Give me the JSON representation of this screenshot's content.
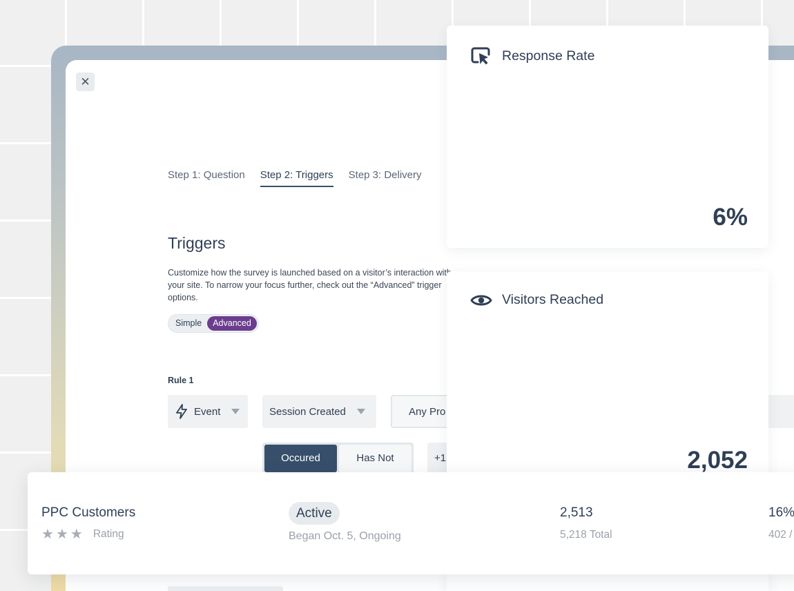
{
  "modal": {
    "close_icon": "close-icon",
    "steps": [
      {
        "label": "Step 1: Question",
        "active": false
      },
      {
        "label": "Step 2: Triggers",
        "active": true
      },
      {
        "label": "Step 3: Delivery",
        "active": false
      }
    ],
    "triggers_title": "Triggers",
    "triggers_description": "Customize how the survey is launched based on a visitor’s interaction with your site. To narrow your focus further, check out the “Advanced” trigger options.",
    "mode_toggle": {
      "simple": "Simple",
      "advanced": "Advanced",
      "selected": "Advanced"
    },
    "rule_label": "Rule 1",
    "event_dropdown": {
      "icon": "lightning-icon",
      "value": "Event"
    },
    "session_dropdown": {
      "value": "Session Created"
    },
    "property_dropdown": {
      "value": "Any Pro"
    },
    "occurrence": {
      "occurred": "Occured",
      "has_not": "Has Not",
      "selected": "Occured"
    },
    "add_button": "+1"
  },
  "metrics": {
    "response_rate": {
      "icon": "cursor-click-icon",
      "label": "Response Rate",
      "value": "6%"
    },
    "visitors_reached": {
      "icon": "eye-icon",
      "label": "Visitors Reached",
      "value": "2,052"
    }
  },
  "segment_row": {
    "name": "PPC Customers",
    "rating_label": "Rating",
    "rating_stars": 3,
    "status": "Active",
    "status_detail": "Began Oct. 5, Ongoing",
    "count": "2,513",
    "count_total": "5,218 Total",
    "percent": "16%",
    "percent_detail": "402 /"
  },
  "colors": {
    "accent_purple": "#6c3d8f",
    "navy_button": "#374f6b",
    "text_dark": "#2f3f55",
    "text_muted": "#9aa1a9"
  }
}
